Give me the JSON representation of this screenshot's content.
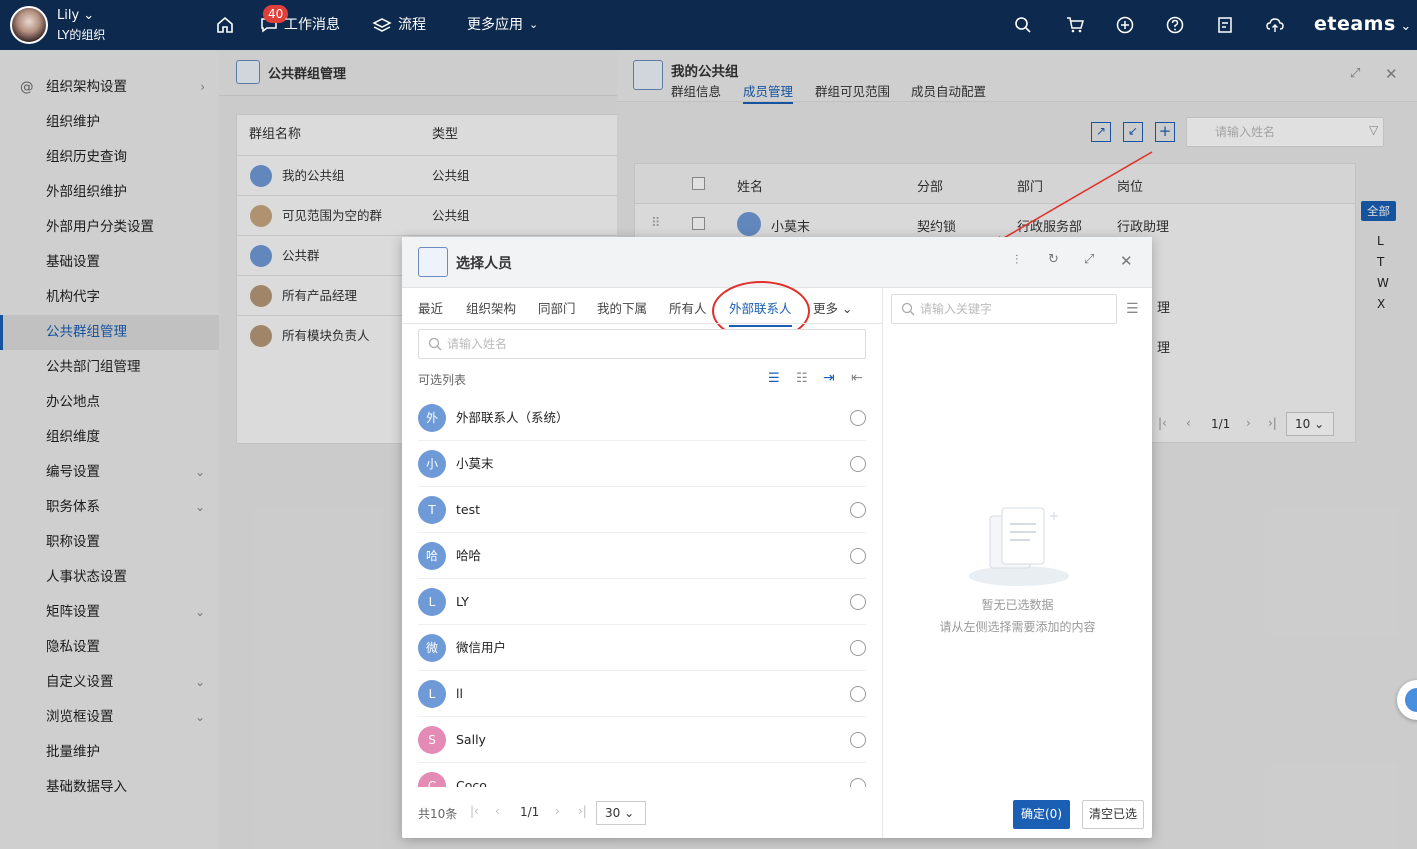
{
  "topbar": {
    "user_name": "Lily",
    "org_name": "LY的组织",
    "badge_count": "40",
    "nav": [
      "工作消息",
      "流程",
      "更多应用"
    ],
    "brand": "eteams"
  },
  "sidebar": {
    "items": [
      {
        "label": "组织架构设置",
        "chev": "›"
      },
      {
        "label": "组织维护"
      },
      {
        "label": "组织历史查询"
      },
      {
        "label": "外部组织维护"
      },
      {
        "label": "外部用户分类设置"
      },
      {
        "label": "基础设置"
      },
      {
        "label": "机构代字"
      },
      {
        "label": "公共群组管理",
        "active": true
      },
      {
        "label": "公共部门组管理"
      },
      {
        "label": "办公地点"
      },
      {
        "label": "组织维度"
      },
      {
        "label": "编号设置",
        "chev": "⌄"
      },
      {
        "label": "职务体系",
        "chev": "⌄"
      },
      {
        "label": "职称设置"
      },
      {
        "label": "人事状态设置"
      },
      {
        "label": "矩阵设置",
        "chev": "⌄"
      },
      {
        "label": "隐私设置"
      },
      {
        "label": "自定义设置",
        "chev": "⌄"
      },
      {
        "label": "浏览框设置",
        "chev": "⌄"
      },
      {
        "label": "批量维护"
      },
      {
        "label": "基础数据导入"
      }
    ]
  },
  "panel1": {
    "title": "公共群组管理",
    "col_name": "群组名称",
    "col_type": "类型",
    "rows": [
      {
        "name": "我的公共组",
        "type": "公共组"
      },
      {
        "name": "可见范围为空的群",
        "type": "公共组"
      },
      {
        "name": "公共群",
        "type": ""
      },
      {
        "name": "所有产品经理",
        "type": ""
      },
      {
        "name": "所有模块负责人",
        "type": ""
      }
    ]
  },
  "panel2": {
    "title": "我的公共组",
    "tabs": [
      "群组信息",
      "成员管理",
      "群组可见范围",
      "成员自动配置"
    ],
    "active_tab": "成员管理",
    "search_placeholder": "请输入姓名",
    "cols": [
      "姓名",
      "分部",
      "部门",
      "岗位"
    ],
    "rows": [
      {
        "name": "小莫末",
        "branch": "契约锁",
        "dept": "行政服务部",
        "post": "行政助理"
      }
    ],
    "partial": [
      "理",
      "理"
    ],
    "page": "1/1",
    "page_size": "10",
    "alpha_all": "全部",
    "alpha": [
      "L",
      "T",
      "W",
      "X"
    ]
  },
  "modal": {
    "title": "选择人员",
    "tabs": [
      "最近",
      "组织架构",
      "同部门",
      "我的下属",
      "所有人",
      "外部联系人",
      "更多"
    ],
    "active_tab": "外部联系人",
    "search_placeholder": "请输入姓名",
    "keyword_placeholder": "请输入关键字",
    "list_label": "可选列表",
    "items": [
      {
        "av": "外",
        "name": "外部联系人（系统）",
        "color": "#6f9ad8"
      },
      {
        "av": "小",
        "name": "小莫末",
        "color": "#6f9ad8"
      },
      {
        "av": "T",
        "name": "test",
        "color": "#6f9ad8"
      },
      {
        "av": "哈",
        "name": "哈哈",
        "color": "#6f9ad8"
      },
      {
        "av": "L",
        "name": "LY",
        "color": "#6f9ad8"
      },
      {
        "av": "微",
        "name": "微信用户",
        "color": "#6f9ad8"
      },
      {
        "av": "L",
        "name": "ll",
        "color": "#6f9ad8"
      },
      {
        "av": "S",
        "name": "Sally",
        "color": "#e38bb4"
      },
      {
        "av": "C",
        "name": "Coco",
        "color": "#e38bb4"
      }
    ],
    "total": "共10条",
    "page": "1/1",
    "page_size": "30",
    "empty_title": "暂无已选数据",
    "empty_hint": "请从左侧选择需要添加的内容",
    "ok": "确定(0)",
    "clear": "清空已选"
  }
}
